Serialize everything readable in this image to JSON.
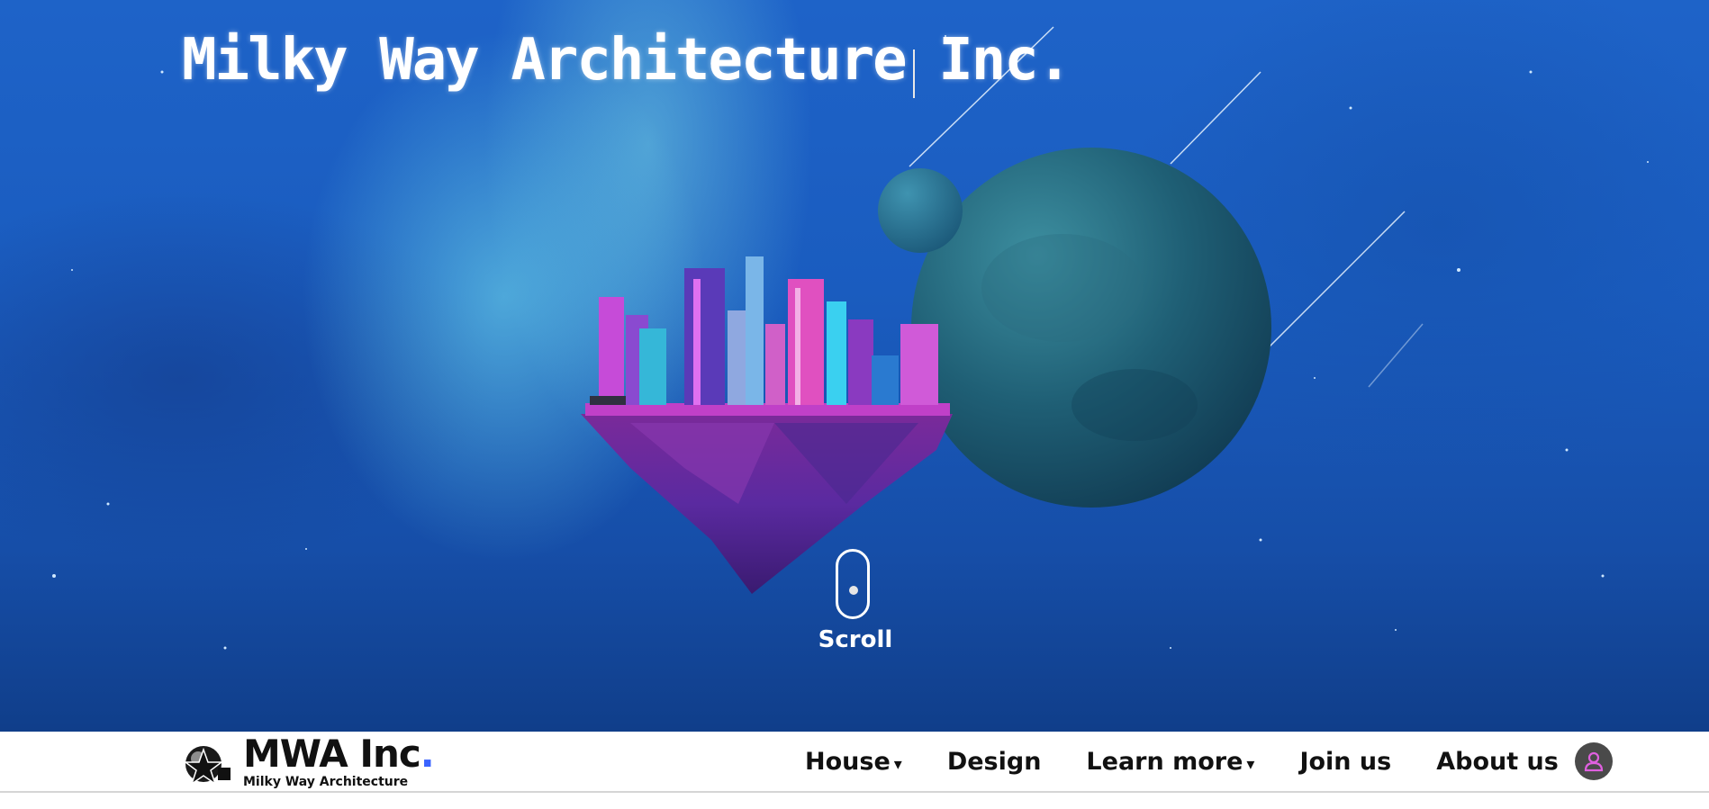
{
  "hero": {
    "title": "Milky Way Architecture Inc.",
    "scroll_label": "Scroll"
  },
  "navbar": {
    "brand": "MWA Inc",
    "brand_dot": ".",
    "brand_subtitle": "Milky Way Architecture",
    "items": [
      {
        "label": "House",
        "has_dropdown": true,
        "caret": "▾"
      },
      {
        "label": "Design",
        "has_dropdown": false
      },
      {
        "label": "Learn more",
        "has_dropdown": true,
        "caret": "▾"
      },
      {
        "label": "Join us",
        "has_dropdown": false
      },
      {
        "label": "About us",
        "has_dropdown": false
      }
    ],
    "user_icon": "user-icon"
  },
  "colors": {
    "sky_blue": "#1a5cbf",
    "accent_pink": "#e060e0",
    "brand_dot": "#3a63ff",
    "navbar_bg": "#ffffff",
    "text_dark": "#111111"
  }
}
